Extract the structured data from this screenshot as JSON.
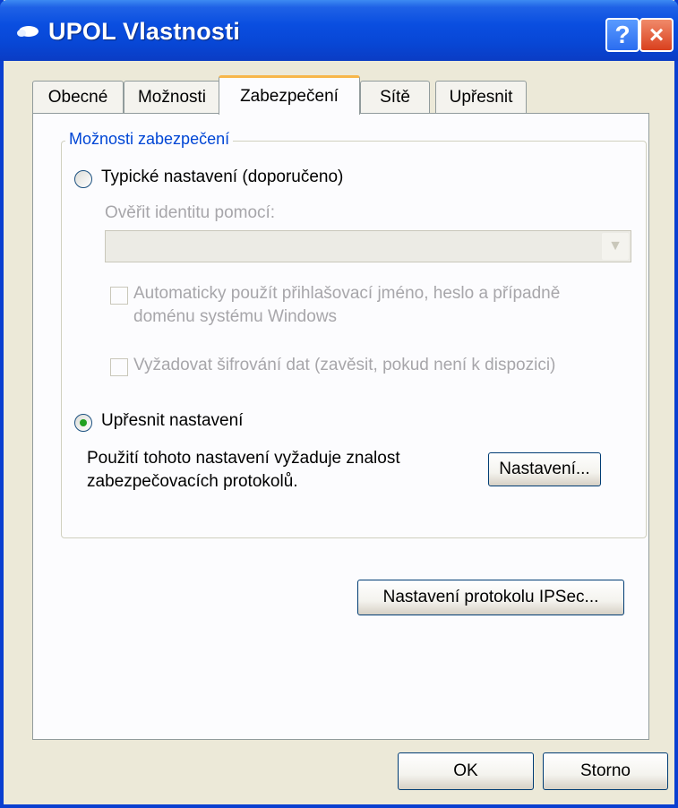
{
  "window": {
    "title": "UPOL Vlastnosti",
    "help_label": "?",
    "close_label": "×"
  },
  "tabs": [
    {
      "label": "Obecné",
      "active": false
    },
    {
      "label": "Možnosti",
      "active": false
    },
    {
      "label": "Zabezpečení",
      "active": true
    },
    {
      "label": "Sítě",
      "active": false
    },
    {
      "label": "Upřesnit",
      "active": false
    }
  ],
  "security": {
    "group_title": "Možnosti zabezpečení",
    "typical": {
      "label": "Typické nastavení (doporučeno)",
      "selected": false,
      "verify_label": "Ověřit identitu pomocí:",
      "verify_value": "",
      "auto_login_line1": "Automaticky použít přihlašovací jméno, heslo a případně",
      "auto_login_line2": "doménu systému Windows",
      "auto_login_checked": false,
      "require_encryption": "Vyžadovat šifrování dat (zavěsit, pokud není k dispozici)",
      "require_encryption_checked": false
    },
    "advanced": {
      "label": "Upřesnit nastavení",
      "selected": true,
      "description_line1": "Použití tohoto nastavení vyžaduje znalost",
      "description_line2": "zabezpečovacích protokolů.",
      "settings_button": "Nastavení..."
    }
  },
  "ipsec_button": "Nastavení protokolu IPSec...",
  "footer": {
    "ok_label": "OK",
    "cancel_label": "Storno"
  },
  "colors": {
    "titlebar": "#0a4ee0",
    "group_title": "#0046d5",
    "radio_dot": "#21a121",
    "disabled_text": "#a7a6aa",
    "active_tab_highlight": "#f7b64a"
  }
}
